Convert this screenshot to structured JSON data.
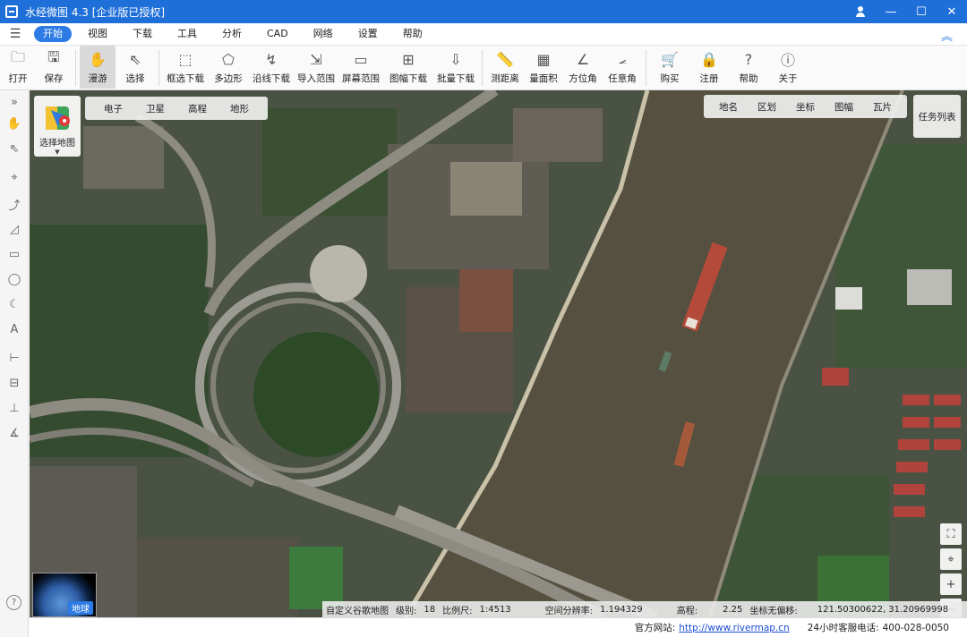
{
  "window": {
    "title": "水经微图 4.3 [企业版已授权]",
    "controls": [
      "user-icon",
      "minimize-icon",
      "maximize-icon",
      "close-icon"
    ]
  },
  "menu": {
    "items": [
      "开始",
      "视图",
      "下载",
      "工具",
      "分析",
      "CAD",
      "网络",
      "设置",
      "帮助"
    ],
    "active": "开始"
  },
  "toolbar": {
    "items": [
      {
        "label": "打开",
        "icon": "folder-icon",
        "dropdown": true
      },
      {
        "label": "保存",
        "icon": "save-icon"
      },
      {
        "label": "漫游",
        "icon": "hand-icon",
        "active": true
      },
      {
        "label": "选择",
        "icon": "cursor-icon"
      },
      {
        "label": "框选下载",
        "icon": "box-download-icon"
      },
      {
        "label": "多边形",
        "icon": "polygon-icon"
      },
      {
        "label": "沿线下载",
        "icon": "line-download-icon"
      },
      {
        "label": "导入范围",
        "icon": "import-range-icon"
      },
      {
        "label": "屏幕范围",
        "icon": "screen-range-icon"
      },
      {
        "label": "图幅下载",
        "icon": "sheet-download-icon",
        "dropdown": true
      },
      {
        "label": "批量下载",
        "icon": "batch-download-icon"
      },
      {
        "label": "测距离",
        "icon": "ruler-icon"
      },
      {
        "label": "量面积",
        "icon": "area-icon"
      },
      {
        "label": "方位角",
        "icon": "azimuth-icon"
      },
      {
        "label": "任意角",
        "icon": "angle-icon"
      },
      {
        "label": "购买",
        "icon": "cart-icon"
      },
      {
        "label": "注册",
        "icon": "lock-icon"
      },
      {
        "label": "帮助",
        "icon": "help-icon"
      },
      {
        "label": "关于",
        "icon": "info-icon"
      }
    ]
  },
  "map": {
    "base_layers": [
      "电子",
      "卫星",
      "高程",
      "地形"
    ],
    "overlays": [
      "地名",
      "区划",
      "坐标",
      "图幅",
      "瓦片"
    ],
    "select_map_label": "选择地图",
    "task_list_label": "任务列表",
    "globe_label": "地球"
  },
  "status": {
    "map_source": "自定义谷歌地图",
    "level_label": "级别:",
    "level": "18",
    "scale_label": "比例尺:",
    "scale": "1:4513",
    "resolution_label": "空间分辨率:",
    "resolution": "1.194329",
    "elevation_label": "高程:",
    "elevation": "2.25",
    "coord_label": "坐标无偏移:",
    "coord": "121.50300622, 31.20969998"
  },
  "footer": {
    "site_label": "官方网站:",
    "site_url": "http://www.rivermap.cn",
    "phone_label": "24小时客服电话:",
    "phone": "400-028-0050"
  },
  "colors": {
    "titlebar": "#1f6fd8",
    "accent": "#2d7be5",
    "river": "#55503f",
    "vegetation": "#2f4a2a"
  }
}
